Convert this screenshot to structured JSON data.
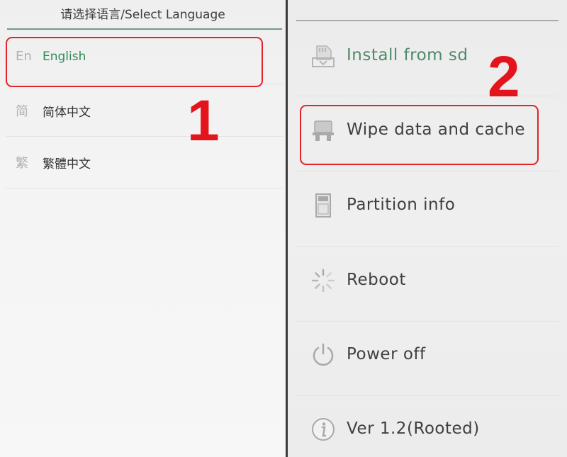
{
  "left_panel": {
    "title": "请选择语言/Select Language",
    "languages": [
      {
        "code": "En",
        "name": "English",
        "selected": true
      },
      {
        "code": "简",
        "name": "简体中文",
        "selected": false
      },
      {
        "code": "繁",
        "name": "繁體中文",
        "selected": false
      }
    ]
  },
  "right_panel": {
    "menu": [
      {
        "label": "Install from sd",
        "icon": "sd-install-icon"
      },
      {
        "label": "Wipe data and cache",
        "icon": "wipe-icon"
      },
      {
        "label": "Partition info",
        "icon": "sd-card-icon"
      },
      {
        "label": "Reboot",
        "icon": "reboot-spinner-icon"
      },
      {
        "label": "Power off",
        "icon": "power-icon"
      },
      {
        "label": "Ver 1.2(Rooted)",
        "icon": "info-icon"
      }
    ]
  },
  "annotations": {
    "step1": "1",
    "step2": "2",
    "highlight_color": "#e2232a"
  }
}
